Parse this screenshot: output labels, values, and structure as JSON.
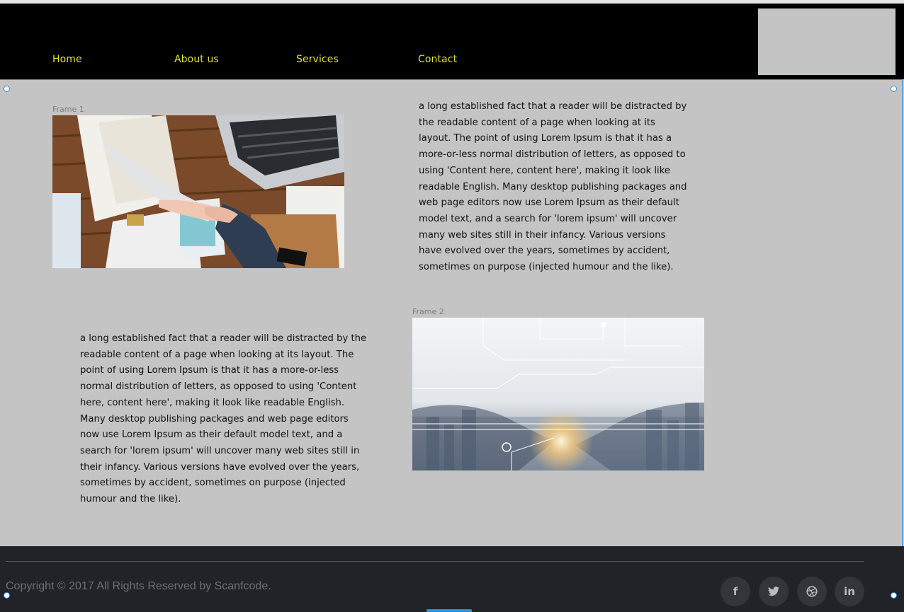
{
  "nav": {
    "items": [
      {
        "label": "Home"
      },
      {
        "label": "About us"
      },
      {
        "label": "Services"
      },
      {
        "label": "Contact"
      }
    ]
  },
  "sections": {
    "frame1_label": "Frame 1",
    "frame2_label": "Frame 2",
    "paragraph1": " a long established fact that a reader will be distracted by the readable content of a page when looking at its layout. The point of using Lorem Ipsum is that it has a more-or-less normal distribution of letters, as opposed to using 'Content here, content here', making it look like readable English. Many desktop publishing packages and web page editors now use Lorem Ipsum as their default model text, and a search for 'lorem ipsum' will uncover many web sites still in their infancy. Various versions have evolved over the years, sometimes by accident, sometimes on purpose (injected humour and the like).",
    "paragraph2": " a long established fact that a reader will be distracted by the readable content of a page when looking at its layout. The point of using Lorem Ipsum is that it has a more-or-less normal distribution of letters, as opposed to using 'Content here, content here', making it look like readable English. Many desktop publishing packages and web page editors now use Lorem Ipsum as their default model text, and a search for 'lorem ipsum' will uncover many web sites still in their infancy. Various versions have evolved over the years, sometimes by accident, sometimes on purpose (injected humour and the like)."
  },
  "footer": {
    "copyright": "Copyright © 2017 All Rights Reserved by Scanfcode.",
    "social": [
      {
        "icon": "facebook-icon",
        "glyph": "f"
      },
      {
        "icon": "twitter-icon",
        "glyph": "🐦"
      },
      {
        "icon": "dribbble-icon",
        "glyph": "◎"
      },
      {
        "icon": "linkedin-icon",
        "glyph": "in"
      }
    ]
  },
  "colors": {
    "header_bg": "#000000",
    "nav_text": "#e5e22a",
    "page_bg": "#c4c4c4",
    "footer_bg": "#222328",
    "selection": "#2d8fe8"
  }
}
